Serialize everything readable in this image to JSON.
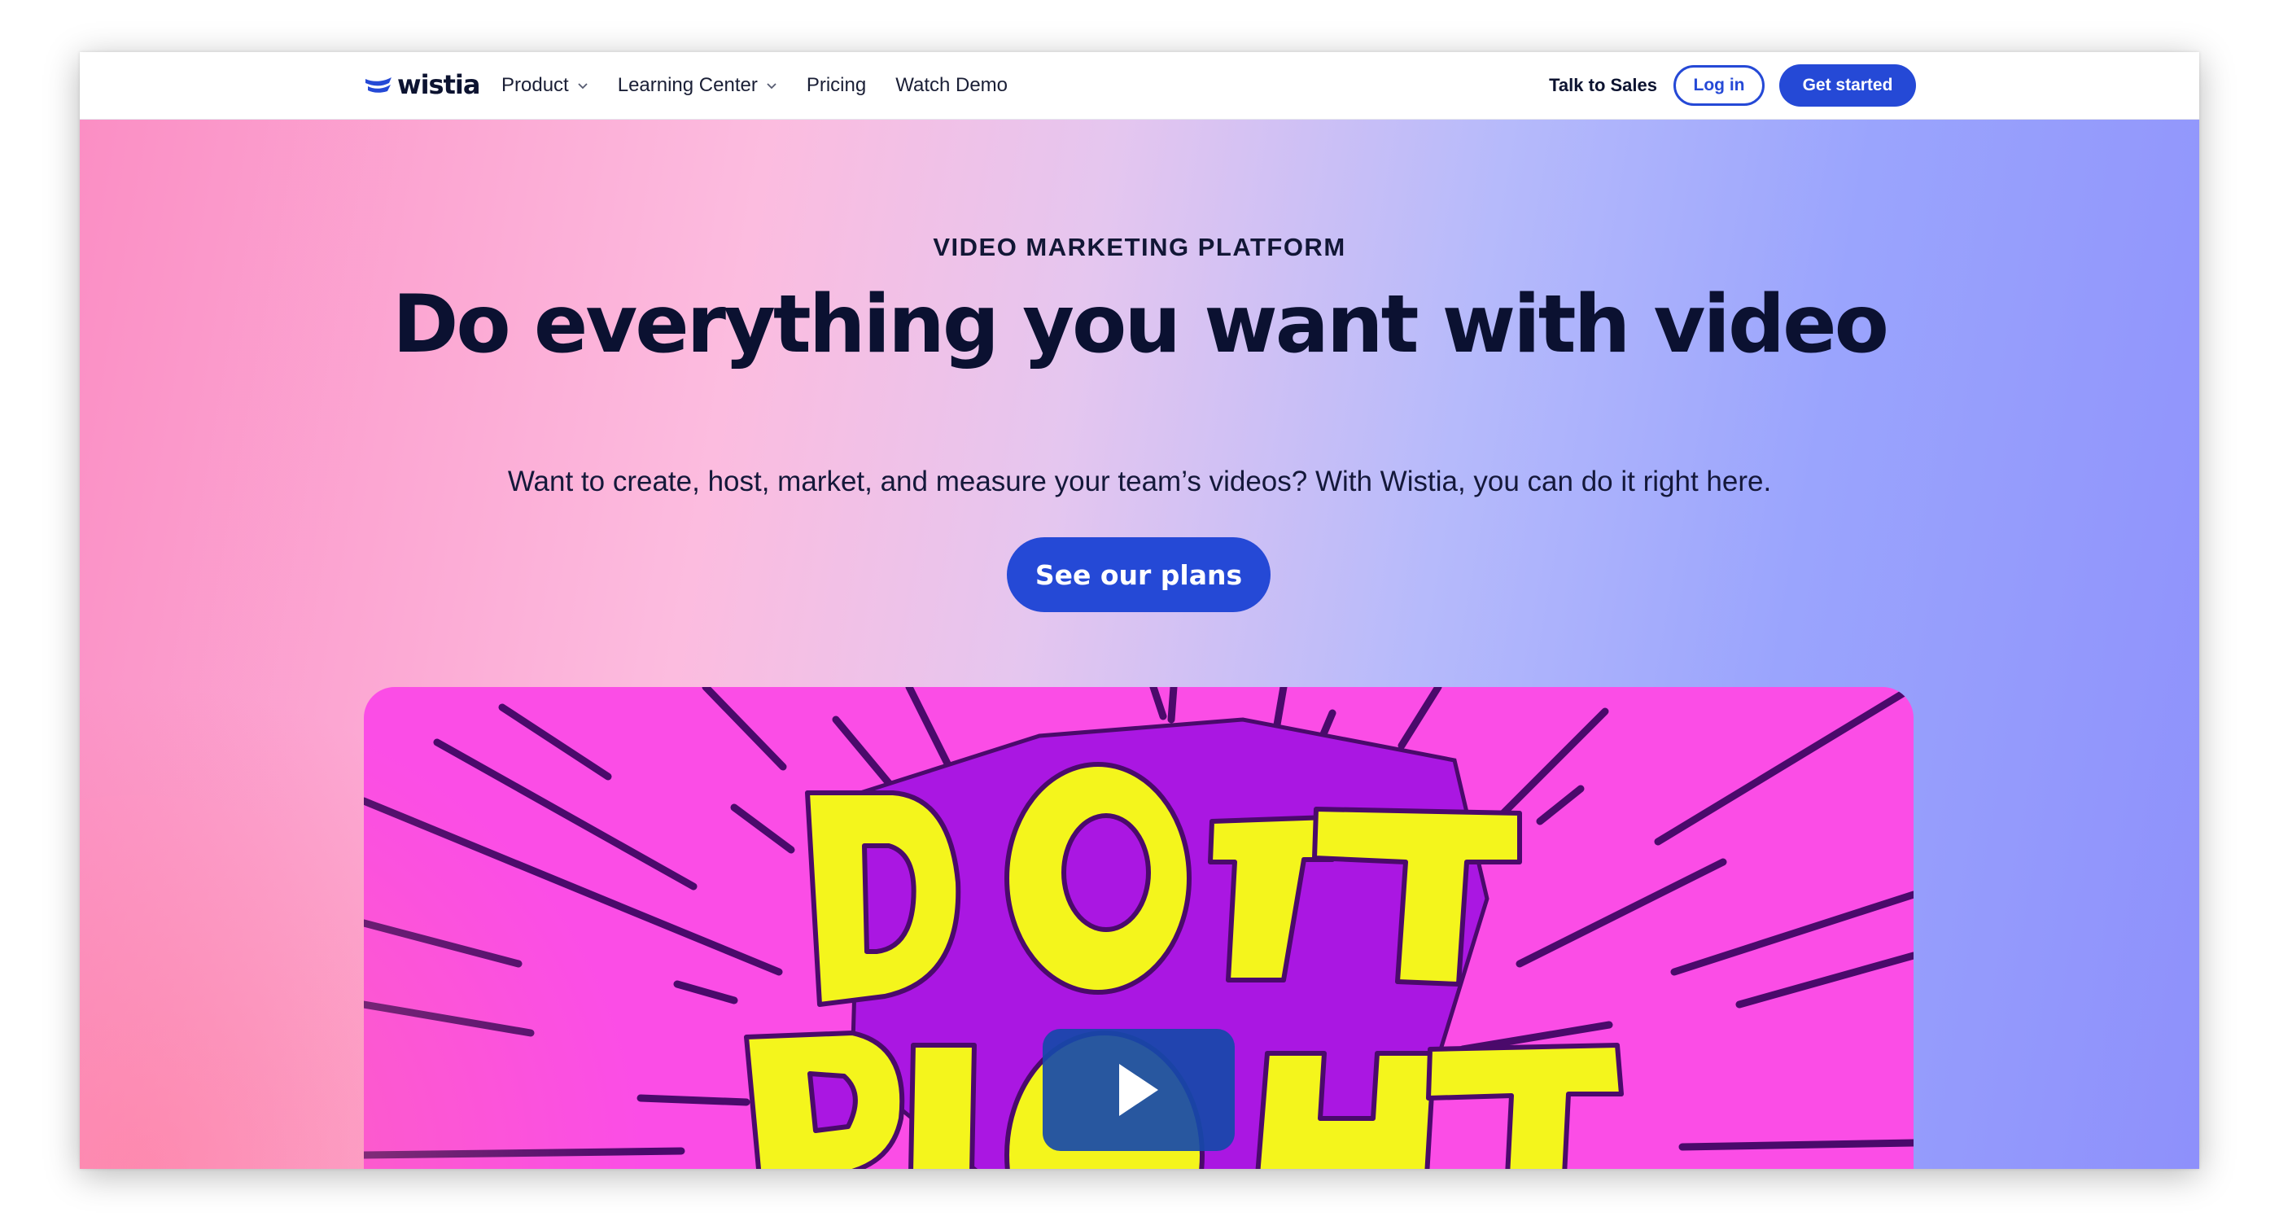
{
  "nav": {
    "logo_text": "wistia",
    "links": [
      "Product",
      "Learning Center",
      "Pricing",
      "Watch Demo"
    ],
    "talk_to_sales": "Talk to Sales",
    "login": "Log in",
    "get_started": "Get started"
  },
  "hero": {
    "eyebrow": "VIDEO MARKETING PLATFORM",
    "headline": "Do everything you want with video",
    "subtext": "Want to create, host, market, and measure your team’s videos? With Wistia, you can do it right here.",
    "cta": "See our plans"
  },
  "video": {
    "title_line1": "DO IT",
    "title_line2": "RIGHT",
    "play_icon": "play-icon"
  },
  "colors": {
    "brand_blue": "#2549d6",
    "navy": "#0b1131",
    "video_magenta": "#fb4de6",
    "video_purple": "#aa17e2",
    "video_yellow": "#f4f51c"
  }
}
